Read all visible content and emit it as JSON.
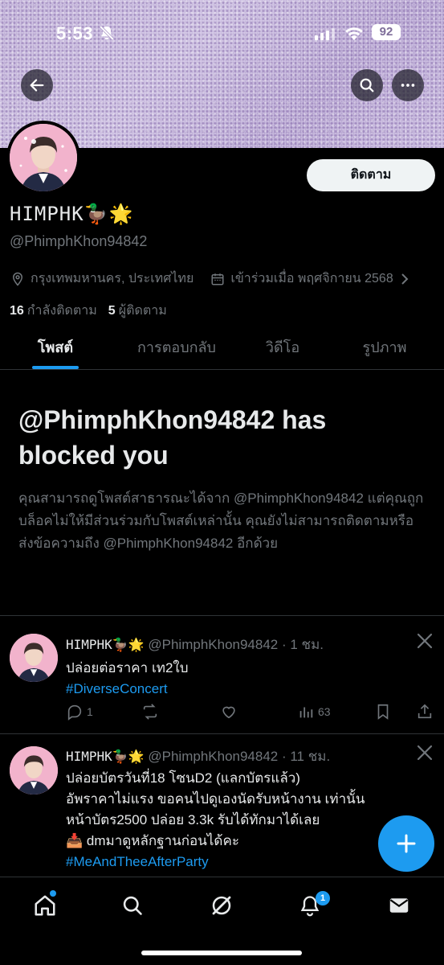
{
  "status_bar": {
    "time": "5:53",
    "battery": "92"
  },
  "profile": {
    "name": "HIMPHK🦆🌟",
    "handle": "@PhimphKhon94842",
    "location": "กรุงเทพมหานคร, ประเทศไทย",
    "joined": "เข้าร่วมเมื่อ พฤศจิกายน 2568",
    "following_count": "16",
    "following_label": "กำลังติดตาม",
    "followers_count": "5",
    "followers_label": "ผู้ติดตาม",
    "follow_button": "ติดตาม"
  },
  "tabs": [
    {
      "label": "โพสต์",
      "active": true
    },
    {
      "label": "การตอบกลับ",
      "active": false
    },
    {
      "label": "วิดีโอ",
      "active": false
    },
    {
      "label": "รูปภาพ",
      "active": false
    }
  ],
  "blocked": {
    "title": "@PhimphKhon94842 has blocked you",
    "description": "คุณสามารถดูโพสต์สาธารณะได้จาก @PhimphKhon94842 แต่คุณถูกบล็อคไม่ให้มีส่วนร่วมกับโพสต์เหล่านั้น คุณยังไม่สามารถติดตามหรือส่งข้อความถึง @PhimphKhon94842 อีกด้วย"
  },
  "posts": [
    {
      "name": "HIMPHK🦆🌟",
      "handle": "@PhimphKhon94842",
      "time": "· 1 ชม.",
      "lines": [
        "ปล่อยต่อราคา เท2ใบ"
      ],
      "hashtag": "#DiverseConcert",
      "replies": "1",
      "views": "63"
    },
    {
      "name": "HIMPHK🦆🌟",
      "handle": "@PhimphKhon94842",
      "time": "· 11 ชม.",
      "lines": [
        "ปล่อยบัตรวันที่18 โซนD2 (แลกบัตรแล้ว)",
        "อัพราคาไม่แรง ขอคนไปดูเองนัดรับหน้างาน เท่านั้น",
        "หน้าบัตร2500 ปล่อย 3.3k รับได้ทักมาได้เลย",
        "📥 dmมาดูหลักฐานก่อนได้คะ"
      ],
      "hashtag": "#MeAndTheeAfterParty"
    }
  ],
  "nav": {
    "notifications_badge": "1"
  },
  "colors": {
    "accent": "#1d9bf0",
    "background": "#000000",
    "muted": "#71767b"
  }
}
